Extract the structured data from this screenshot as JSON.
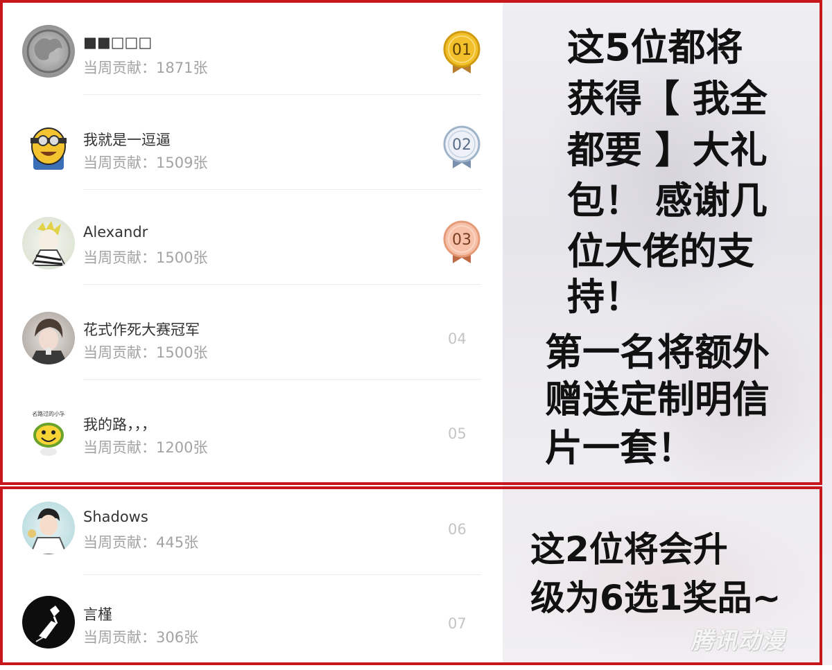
{
  "ranking": [
    {
      "name": "■■□□□",
      "contribution": "当周贡献：1871张",
      "rank": "01",
      "medal": "gold"
    },
    {
      "name": "我就是一逗逼",
      "contribution": "当周贡献：1509张",
      "rank": "02",
      "medal": "silver"
    },
    {
      "name": "Alexandr",
      "contribution": "当周贡献：1500张",
      "rank": "03",
      "medal": "bronze"
    },
    {
      "name": "花式作死大赛冠军",
      "contribution": "当周贡献：1500张",
      "rank": "04",
      "medal": "none"
    },
    {
      "name": "我的路，，，",
      "contribution": "当周贡献：1200张",
      "rank": "05",
      "medal": "none"
    },
    {
      "name": "Shadows",
      "contribution": "当周贡献：445张",
      "rank": "06",
      "medal": "none"
    },
    {
      "name": "言槿",
      "contribution": "当周贡献：306张",
      "rank": "07",
      "medal": "none"
    }
  ],
  "avatar_texts": {
    "avatar_5": "名路过的小学"
  },
  "caption_top": {
    "lines": [
      "这5位都将",
      "获得【 我全",
      "都要 】大礼",
      "包！ 感谢几",
      "位大佬的支",
      "持！"
    ],
    "lines2": [
      "第一名将额外",
      "赠送定制明信",
      "片一套！"
    ]
  },
  "caption_bottom": {
    "lines": [
      "这2位将会升",
      "级为6选1奖品~"
    ]
  },
  "watermark": "腾讯动漫",
  "colors": {
    "frame": "#c8161d",
    "gold": "#e9b51f",
    "silver": "#9fb3c9",
    "bronze": "#e59a78"
  },
  "icons": [
    "gold-medal-icon",
    "silver-medal-icon",
    "bronze-medal-icon"
  ]
}
